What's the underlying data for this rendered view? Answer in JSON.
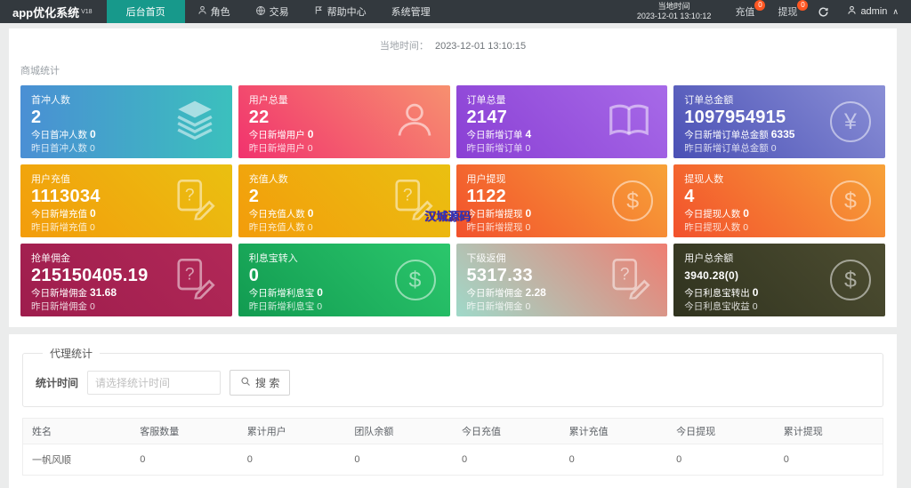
{
  "header": {
    "logo": "app优化系统",
    "logo_sup": "V18",
    "nav": [
      {
        "label": "后台首页",
        "active": true
      },
      {
        "label": "角色",
        "icon": "user-icon"
      },
      {
        "label": "交易",
        "icon": "globe-icon"
      },
      {
        "label": "帮助中心",
        "icon": "flag-icon"
      },
      {
        "label": "系统管理"
      }
    ],
    "local_time_label": "当地时间",
    "local_time_value": "2023-12-01 13:10:12",
    "recharge_label": "充值",
    "recharge_badge": "0",
    "withdraw_label": "提现",
    "withdraw_badge": "0",
    "username": "admin"
  },
  "timebar": {
    "label": "当地时间：",
    "value": "2023-12-01 13:10:15"
  },
  "stats": {
    "section_title": "商城统计",
    "cards": [
      {
        "title": "首冲人数",
        "value": "2",
        "today_label": "今日首冲人数",
        "today_value": "0",
        "yest_label": "昨日首冲人数",
        "yest_value": "0",
        "icon": "layers-icon",
        "gradient": {
          "angle": "90deg",
          "from": "#4a8fd4",
          "to": "#3bc0bd"
        }
      },
      {
        "title": "用户总量",
        "value": "22",
        "today_label": "今日新增用户",
        "today_value": "0",
        "yest_label": "昨日新增用户",
        "yest_value": "0",
        "icon": "user-icon",
        "gradient": {
          "angle": "45deg",
          "from": "#f1326e",
          "to": "#f7906f"
        }
      },
      {
        "title": "订单总量",
        "value": "2147",
        "today_label": "今日新增订单",
        "today_value": "4",
        "yest_label": "昨日新增订单",
        "yest_value": "0",
        "icon": "book-icon",
        "gradient": {
          "angle": "45deg",
          "from": "#8a3fd4",
          "to": "#a76ae8"
        }
      },
      {
        "title": "订单总金额",
        "value": "1097954915",
        "today_label": "今日新增订单总金额",
        "today_value": "6335",
        "yest_label": "昨日新增订单总金额",
        "yest_value": "0",
        "icon": "yen-circle-icon",
        "gradient": {
          "angle": "45deg",
          "from": "#4a50b5",
          "to": "#8a8fd6"
        }
      },
      {
        "title": "用户充值",
        "value": "1113034",
        "today_label": "今日新增充值",
        "today_value": "0",
        "yest_label": "昨日新增充值",
        "yest_value": "0",
        "icon": "edit-doc-icon",
        "gradient": {
          "angle": "45deg",
          "from": "#f39c0b",
          "to": "#eac011"
        }
      },
      {
        "title": "充值人数",
        "value": "2",
        "today_label": "今日充值人数",
        "today_value": "0",
        "yest_label": "昨日充值人数",
        "yest_value": "0",
        "icon": "edit-doc-icon",
        "gradient": {
          "angle": "45deg",
          "from": "#f39c0b",
          "to": "#eac011"
        }
      },
      {
        "title": "用户提现",
        "value": "1122",
        "today_label": "今日新增提现",
        "today_value": "0",
        "yest_label": "昨日新增提现",
        "yest_value": "0",
        "icon": "dollar-circle-icon",
        "gradient": {
          "angle": "45deg",
          "from": "#f2512c",
          "to": "#f7a238"
        }
      },
      {
        "title": "提现人数",
        "value": "4",
        "today_label": "今日提现人数",
        "today_value": "0",
        "yest_label": "昨日提现人数",
        "yest_value": "0",
        "icon": "dollar-circle-icon",
        "gradient": {
          "angle": "45deg",
          "from": "#f2512c",
          "to": "#f7a238"
        }
      },
      {
        "title": "抢单佣金",
        "value": "215150405.19",
        "today_label": "今日新增佣金",
        "today_value": "31.68",
        "yest_label": "昨日新增佣金",
        "yest_value": "0",
        "icon": "edit-doc-icon",
        "gradient": {
          "angle": "45deg",
          "from": "#9e1d4d",
          "to": "#b12857"
        }
      },
      {
        "title": "利息宝转入",
        "value": "0",
        "today_label": "今日新增利息宝",
        "today_value": "0",
        "yest_label": "昨日新增利息宝",
        "yest_value": "0",
        "icon": "dollar-circle-icon",
        "gradient": {
          "angle": "45deg",
          "from": "#129b51",
          "to": "#2bc76c"
        }
      },
      {
        "title": "下级返佣",
        "value": "5317.33",
        "today_label": "今日新增佣金",
        "today_value": "2.28",
        "yest_label": "昨日新增佣金",
        "yest_value": "0",
        "icon": "edit-doc-icon",
        "gradient": {
          "angle": "45deg",
          "from": "#9fd9c9",
          "to": "#ee7e72"
        }
      },
      {
        "title": "用户总余额",
        "value": "3940.28(0)",
        "today_label": "今日利息宝转出",
        "today_value": "0",
        "yest_label": "今日利息宝收益",
        "yest_value": "0",
        "icon": "dollar-circle-icon",
        "gradient": {
          "angle": "45deg",
          "from": "#30331f",
          "to": "#4d4d31"
        },
        "small_value": true
      }
    ]
  },
  "watermark": "汉城源码",
  "agent": {
    "legend": "代理统计",
    "time_label": "统计时间",
    "time_placeholder": "请选择统计时间",
    "search_label": "搜 索"
  },
  "table": {
    "headers": [
      "姓名",
      "客服数量",
      "累计用户",
      "团队余额",
      "今日充值",
      "累计充值",
      "今日提现",
      "累计提现"
    ],
    "rows": [
      [
        "一帆风顺",
        "0",
        "0",
        "0",
        "0",
        "0",
        "0",
        "0"
      ]
    ]
  },
  "colors": {
    "header_bg": "#33393e",
    "active_tab": "#17998b",
    "badge": "#ff5722",
    "page_bg": "#ebecec"
  }
}
